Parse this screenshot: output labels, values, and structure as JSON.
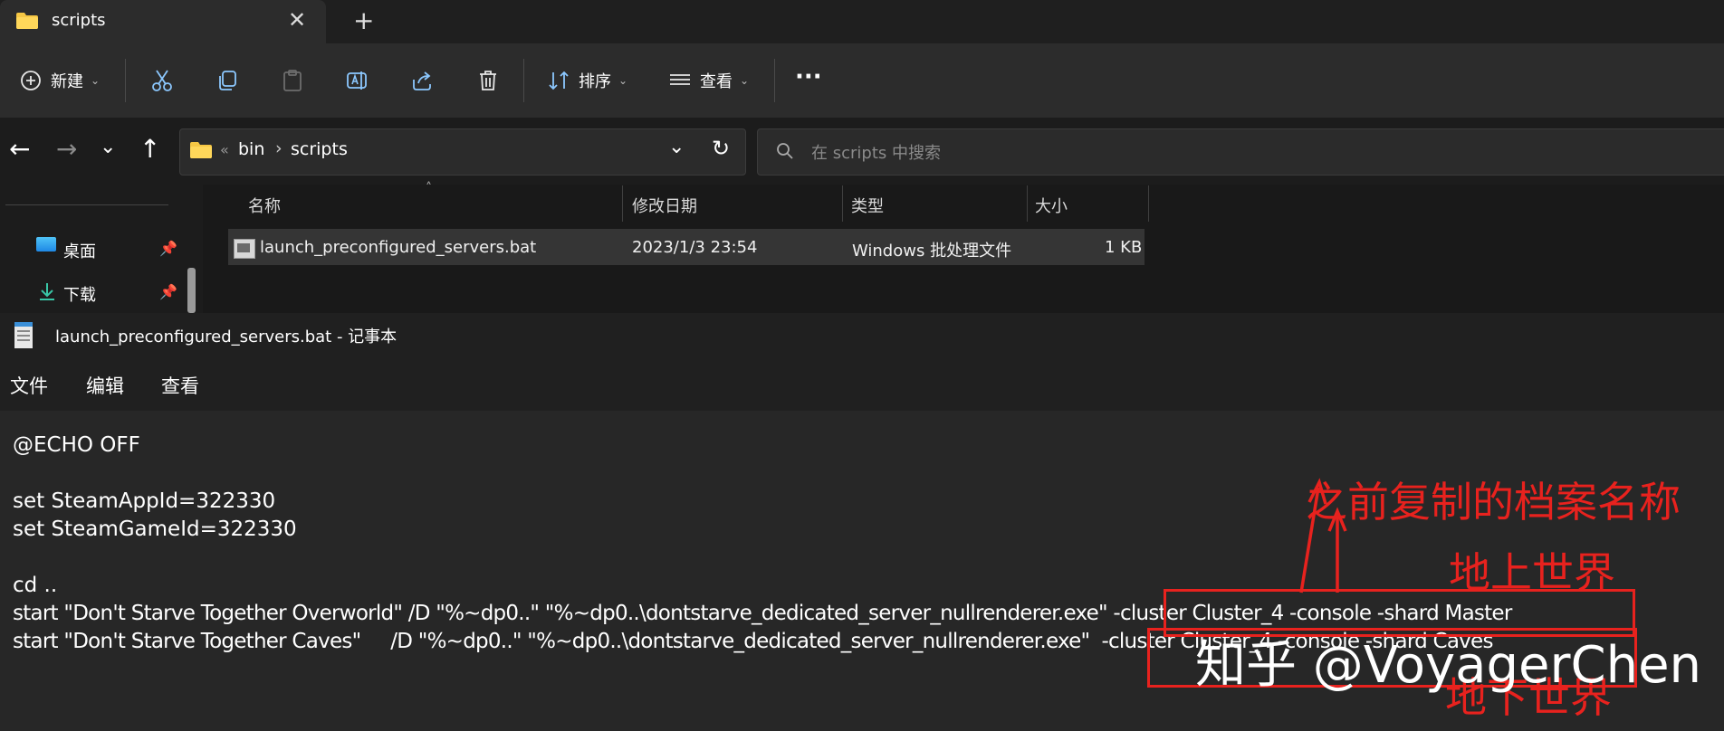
{
  "explorer": {
    "tab": {
      "title": "scripts",
      "close_glyph": "✕",
      "new_glyph": "+"
    },
    "toolbar": {
      "new_label": "新建",
      "sort_label": "排序",
      "view_label": "查看",
      "more_glyph": "···"
    },
    "address": {
      "chevrons": "«",
      "crumbs": [
        "bin",
        "scripts"
      ],
      "separator": "›"
    },
    "search": {
      "placeholder": "在 scripts 中搜索"
    },
    "sidebar": [
      {
        "label": "桌面"
      },
      {
        "label": "下载"
      }
    ],
    "columns": [
      "名称",
      "修改日期",
      "类型",
      "大小"
    ],
    "files": [
      {
        "name": "launch_preconfigured_servers.bat",
        "modified": "2023/1/3 23:54",
        "type": "Windows 批处理文件",
        "size": "1 KB"
      }
    ]
  },
  "notepad": {
    "title": "launch_preconfigured_servers.bat - 记事本",
    "menu": [
      "文件",
      "编辑",
      "查看"
    ],
    "lines": [
      "@ECHO OFF",
      "",
      "set SteamAppId=322330",
      "set SteamGameId=322330",
      "",
      "cd ..",
      "start \"Don't Starve Together Overworld\" /D \"%~dp0..\" \"%~dp0..\\dontstarve_dedicated_server_nullrenderer.exe\" -cluster Cluster_4 -console -shard Master",
      "start \"Don't Starve Together Caves\"     /D \"%~dp0..\" \"%~dp0..\\dontstarve_dedicated_server_nullrenderer.exe\"  -cluster Cluster_4 -console -shard Caves"
    ]
  },
  "annotations": {
    "archive_name": "之前复制的档案名称",
    "overworld": "地上世界",
    "caves": "地下世界",
    "color": "#e8221e"
  },
  "watermark": "知乎 @VoyagerChen"
}
